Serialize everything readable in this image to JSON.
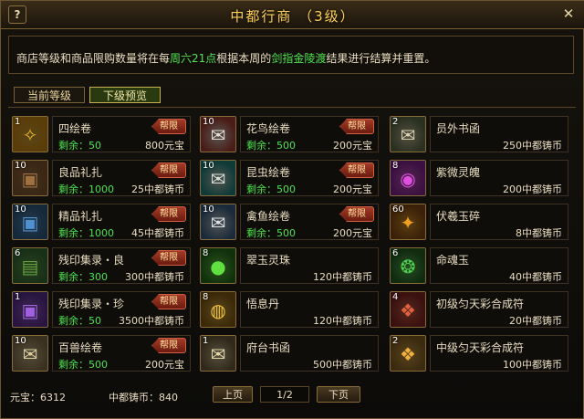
{
  "window": {
    "title": "中都行商 （3级）",
    "help_label": "?",
    "close_label": "✕"
  },
  "notice": {
    "part1": "商店等级和商品限购数量将在每",
    "part2": "周六21点",
    "part3": "根据本周的",
    "part4": "剑指金陵渡",
    "part5": "结果进行结算并重置。"
  },
  "tabs": [
    {
      "label": "当前等级"
    },
    {
      "label": "下级预览"
    }
  ],
  "badge_label": "帮限",
  "colors": {
    "accent": "#ffd257",
    "green": "#4fe24f",
    "border": "#8a6a36"
  },
  "items": [
    {
      "count": "1",
      "icon": "scroll-gold-icon",
      "name": "四绘卷",
      "remain": "剩余：50",
      "price": "800元宝",
      "limited": true
    },
    {
      "count": "10",
      "icon": "scroll-red-icon",
      "name": "花鸟绘卷",
      "remain": "剩余：500",
      "price": "200元宝",
      "limited": true
    },
    {
      "count": "2",
      "icon": "letter-icon",
      "name": "员外书函",
      "remain": "",
      "price": "250中都铸币",
      "limited": false
    },
    {
      "count": "10",
      "icon": "chest-brown-icon",
      "name": "良品礼扎",
      "remain": "剩余：1000",
      "price": "25中都铸币",
      "limited": true
    },
    {
      "count": "10",
      "icon": "scroll-teal-icon",
      "name": "昆虫绘卷",
      "remain": "剩余：500",
      "price": "200元宝",
      "limited": true
    },
    {
      "count": "8",
      "icon": "soul-orb-icon",
      "name": "紫微灵魄",
      "remain": "",
      "price": "200中都铸币",
      "limited": false
    },
    {
      "count": "10",
      "icon": "chest-blue-icon",
      "name": "精品礼扎",
      "remain": "剩余：1000",
      "price": "45中都铸币",
      "limited": true
    },
    {
      "count": "10",
      "icon": "scroll-blue-icon",
      "name": "禽鱼绘卷",
      "remain": "剩余：500",
      "price": "200元宝",
      "limited": true
    },
    {
      "count": "60",
      "icon": "jade-shard-icon",
      "name": "伏羲玉碎",
      "remain": "",
      "price": "8中都铸币",
      "limited": false
    },
    {
      "count": "6",
      "icon": "book-green-icon",
      "name": "残印集录・良",
      "remain": "剩余：300",
      "price": "300中都铸币",
      "limited": true
    },
    {
      "count": "8",
      "icon": "green-pearl-icon",
      "name": "翠玉灵珠",
      "remain": "",
      "price": "120中都铸币",
      "limited": false
    },
    {
      "count": "6",
      "icon": "soul-jade-icon",
      "name": "命魂玉",
      "remain": "",
      "price": "40中都铸币",
      "limited": false
    },
    {
      "count": "1",
      "icon": "chest-purple-icon",
      "name": "残印集录・珍",
      "remain": "剩余：50",
      "price": "3500中都铸币",
      "limited": true
    },
    {
      "count": "8",
      "icon": "pill-icon",
      "name": "悟息丹",
      "remain": "",
      "price": "120中都铸币",
      "limited": false
    },
    {
      "count": "4",
      "icon": "token-red-icon",
      "name": "初级匀天彩合成符",
      "remain": "",
      "price": "20中都铸币",
      "limited": false
    },
    {
      "count": "10",
      "icon": "scroll-paper-icon",
      "name": "百兽绘卷",
      "remain": "剩余：500",
      "price": "200元宝",
      "limited": true
    },
    {
      "count": "1",
      "icon": "letter-gold-icon",
      "name": "府台书函",
      "remain": "",
      "price": "500中都铸币",
      "limited": false
    },
    {
      "count": "2",
      "icon": "token-gold-icon",
      "name": "中级匀天彩合成符",
      "remain": "",
      "price": "100中都铸币",
      "limited": false
    }
  ],
  "footer": {
    "gold": "元宝：6312",
    "coins": "中都铸币：840",
    "prev_label": "上页",
    "page": "1/2",
    "next_label": "下页"
  }
}
